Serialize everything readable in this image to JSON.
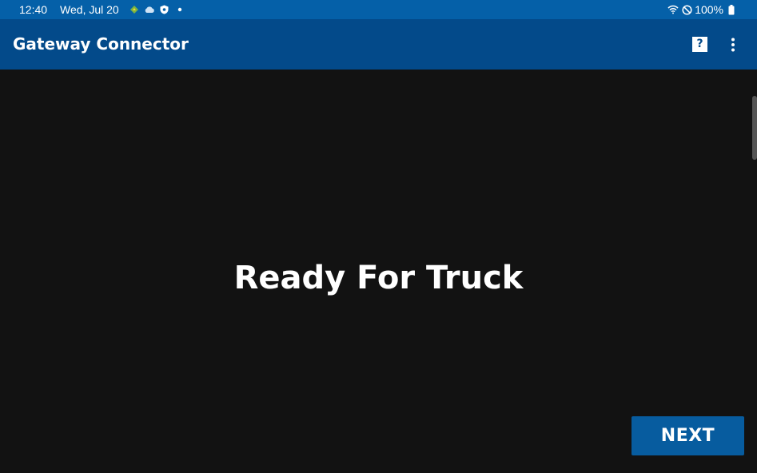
{
  "status_bar": {
    "time": "12:40",
    "date": "Wed, Jul 20",
    "battery": "100%",
    "icons": [
      "maps-icon",
      "cloud-icon",
      "shield-icon",
      "dot-icon",
      "wifi-icon",
      "do-not-disturb-icon",
      "battery-icon"
    ]
  },
  "app_bar": {
    "title": "Gateway Connector",
    "help_label": "?",
    "icons": [
      "help-icon",
      "more-vert-icon"
    ]
  },
  "main": {
    "headline": "Ready For Truck",
    "next_label": "NEXT"
  },
  "colors": {
    "status_bar": "#0560a8",
    "app_bar": "#034a8a",
    "background": "#121212",
    "button": "#075c9f",
    "text": "#ffffff"
  }
}
